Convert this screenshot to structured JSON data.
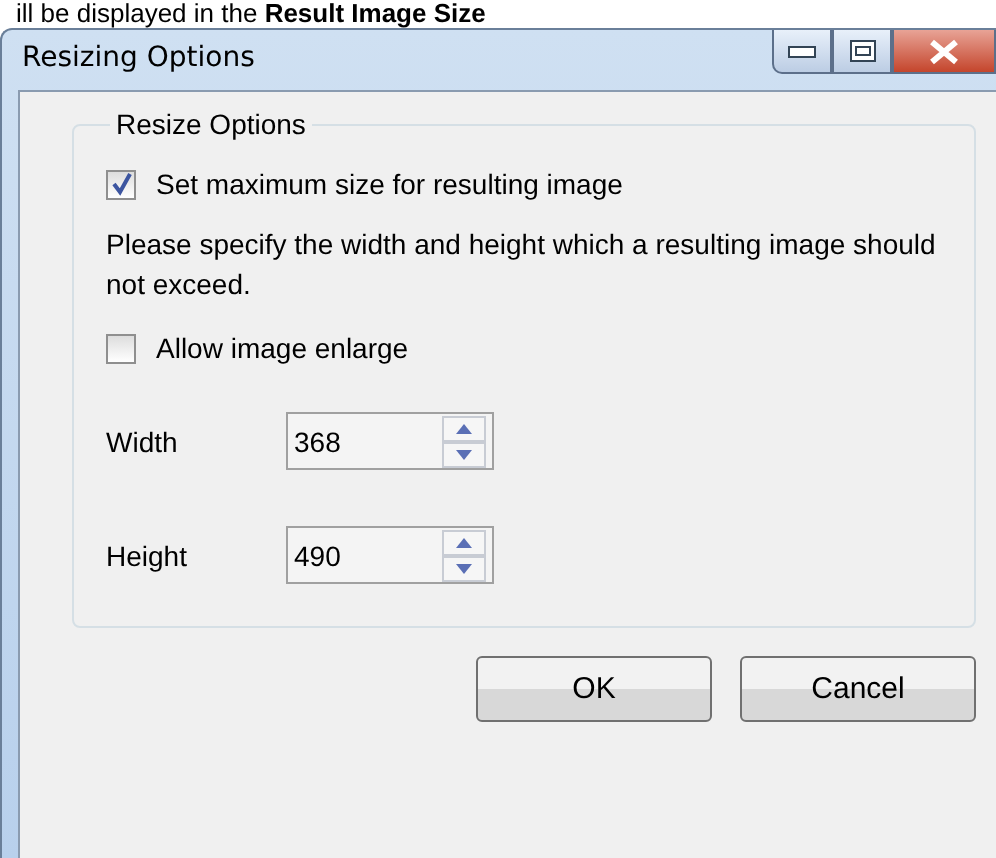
{
  "caption": "ill be displayed in the **Result Image Size**",
  "window": {
    "title": "Resizing Options"
  },
  "group": {
    "title": "Resize Options"
  },
  "options": [
    {
      "kind": "checkbox",
      "label": "Set maximum size for resulting image",
      "checked": true
    },
    {
      "kind": "note",
      "text": "Please specify the width and height which a resulting image should not exceed."
    },
    {
      "kind": "checkbox",
      "label": "Allow image enlarge",
      "checked": false
    }
  ],
  "fields": [
    {
      "label": "Width",
      "value": "368"
    },
    {
      "label": "Height",
      "value": "490"
    }
  ],
  "buttons": [
    "OK",
    "Cancel"
  ]
}
